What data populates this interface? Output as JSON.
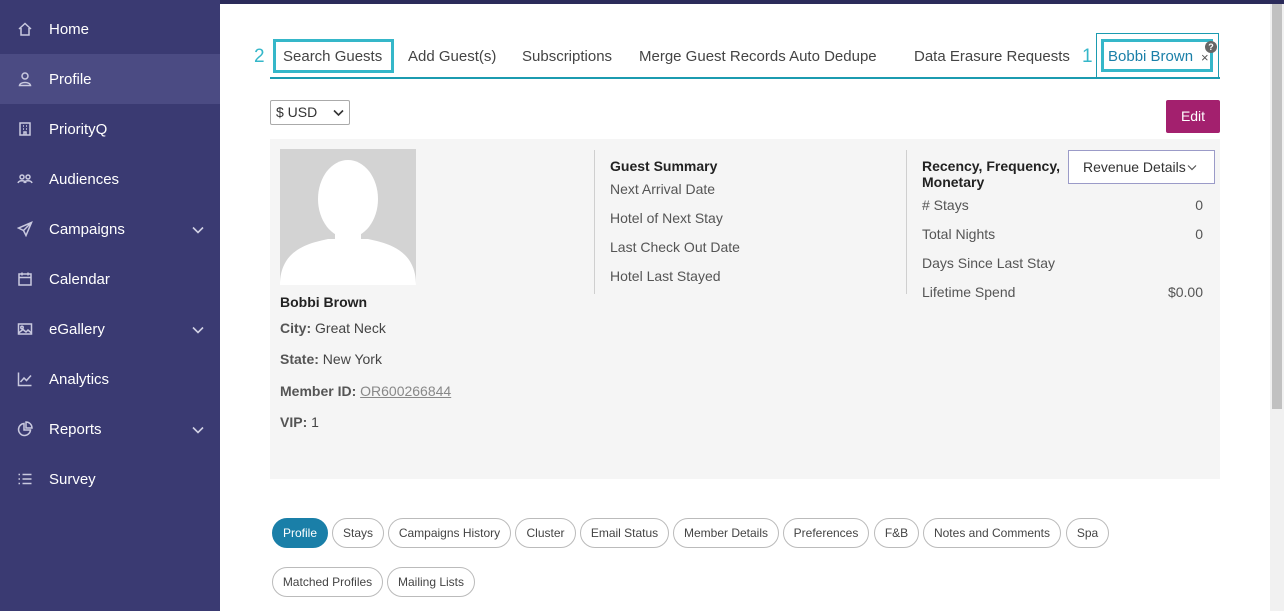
{
  "sidebar": {
    "items": [
      {
        "label": "Home",
        "icon": "home-icon"
      },
      {
        "label": "Profile",
        "icon": "user-icon"
      },
      {
        "label": "PriorityQ",
        "icon": "building-icon"
      },
      {
        "label": "Audiences",
        "icon": "group-icon"
      },
      {
        "label": "Campaigns",
        "icon": "paper-plane-icon"
      },
      {
        "label": "Calendar",
        "icon": "calendar-icon"
      },
      {
        "label": "eGallery",
        "icon": "image-icon"
      },
      {
        "label": "Analytics",
        "icon": "chart-line-icon"
      },
      {
        "label": "Reports",
        "icon": "pie-chart-icon"
      },
      {
        "label": "Survey",
        "icon": "list-icon"
      }
    ],
    "active": "Profile",
    "colors": {
      "background": "#3a3a72",
      "active": "#4b4b83"
    }
  },
  "tabs": {
    "items": [
      "Search Guests",
      "Add Guest(s)",
      "Subscriptions",
      "Merge Guest Records Auto Dedupe",
      "Data Erasure Requests",
      "Bobbi Brown"
    ],
    "close_glyph": "×",
    "badge": "?",
    "step_labels": [
      "2",
      "1"
    ]
  },
  "currency": {
    "selected": "$ USD"
  },
  "edit_label": "Edit",
  "guest": {
    "name": "Bobbi Brown",
    "city_label": "City:",
    "city": "Great Neck",
    "state_label": "State:",
    "state": "New York",
    "member_label": "Member ID:",
    "member_id": "OR600266844",
    "vip_label": "VIP:",
    "vip": "1"
  },
  "summary": {
    "title": "Guest Summary",
    "rows": [
      "Next Arrival Date",
      "Hotel of Next Stay",
      "Last Check Out Date",
      "Hotel Last Stayed"
    ]
  },
  "rfm": {
    "title_line1": "Recency, Frequency,",
    "title_line2": "Monetary",
    "revenue_button": "Revenue Details",
    "rows": [
      {
        "label": "# Stays",
        "value": "0"
      },
      {
        "label": "Total Nights",
        "value": "0"
      },
      {
        "label": "Days Since Last Stay",
        "value": ""
      },
      {
        "label": "Lifetime Spend",
        "value": "$0.00"
      }
    ]
  },
  "profile_tabs": [
    "Profile",
    "Stays",
    "Campaigns History",
    "Cluster",
    "Email Status",
    "Member Details",
    "Preferences",
    "F&B",
    "Notes and Comments",
    "Spa",
    "Matched Profiles",
    "Mailing Lists"
  ],
  "colors": {
    "accent": "#35b7c9",
    "edit": "#a3206e",
    "pill_active": "#1a7fa8"
  }
}
